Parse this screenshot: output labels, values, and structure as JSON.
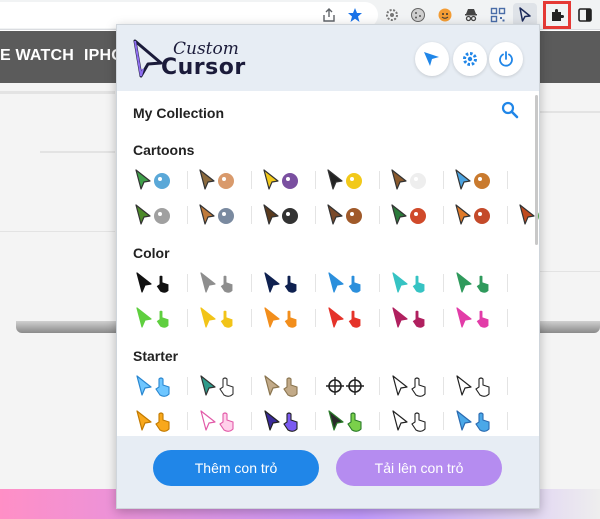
{
  "browser": {
    "toolbar_icons": [
      "share-icon",
      "bookmark-star-icon",
      "extension-gear-icon",
      "extension-cookie-icon",
      "extension-face-icon",
      "extension-spy-icon",
      "extension-qr-icon",
      "custom-cursor-extension-icon",
      "extensions-puzzle-icon",
      "sidebar-icon"
    ]
  },
  "website": {
    "nav": [
      "E WATCH",
      "IPHO"
    ]
  },
  "popup": {
    "logo": {
      "line1": "Custom",
      "line2": "Cursor"
    },
    "header_buttons": [
      "cursor-arrow-icon",
      "settings-gear-icon",
      "power-icon"
    ],
    "collection_title": "My Collection",
    "sections": [
      {
        "title": "Cartoons",
        "rows": [
          [
            "ninja-turtle",
            "groot",
            "minion",
            "felix-cat",
            "bear-panda",
            "bird-duo"
          ],
          [
            "shrek",
            "tom-jerry",
            "boy-char",
            "ostrich",
            "ben10",
            "garfield",
            "dragon-grinch"
          ]
        ]
      },
      {
        "title": "Color",
        "colors": [
          [
            "#111111",
            "#8e8e8e",
            "#0f2150",
            "#2b8fdc",
            "#36c3c3",
            "#2f9a5c"
          ],
          [
            "#5fcf3f",
            "#f2c418",
            "#f28e1c",
            "#e5332a",
            "#b0205f",
            "#e23ca8"
          ]
        ]
      },
      {
        "title": "Starter",
        "rows": [
          [
            "sky-arrow-hand",
            "paper-plane-fist",
            "beige-arrow",
            "crosshair",
            "outline-arrow-hand",
            "grab-hand"
          ],
          [
            "yellow-star",
            "pink-outline-hand",
            "purple-arrow-hand",
            "green-sparkle",
            "pointer-hand",
            "blue-move"
          ]
        ]
      }
    ],
    "buttons": {
      "add": "Thêm con trỏ",
      "upload": "Tải lên con trỏ"
    },
    "colors": {
      "header_bg": "#e7edf4",
      "accent_blue": "#2086e8",
      "accent_purple": "#b58cf0"
    }
  }
}
